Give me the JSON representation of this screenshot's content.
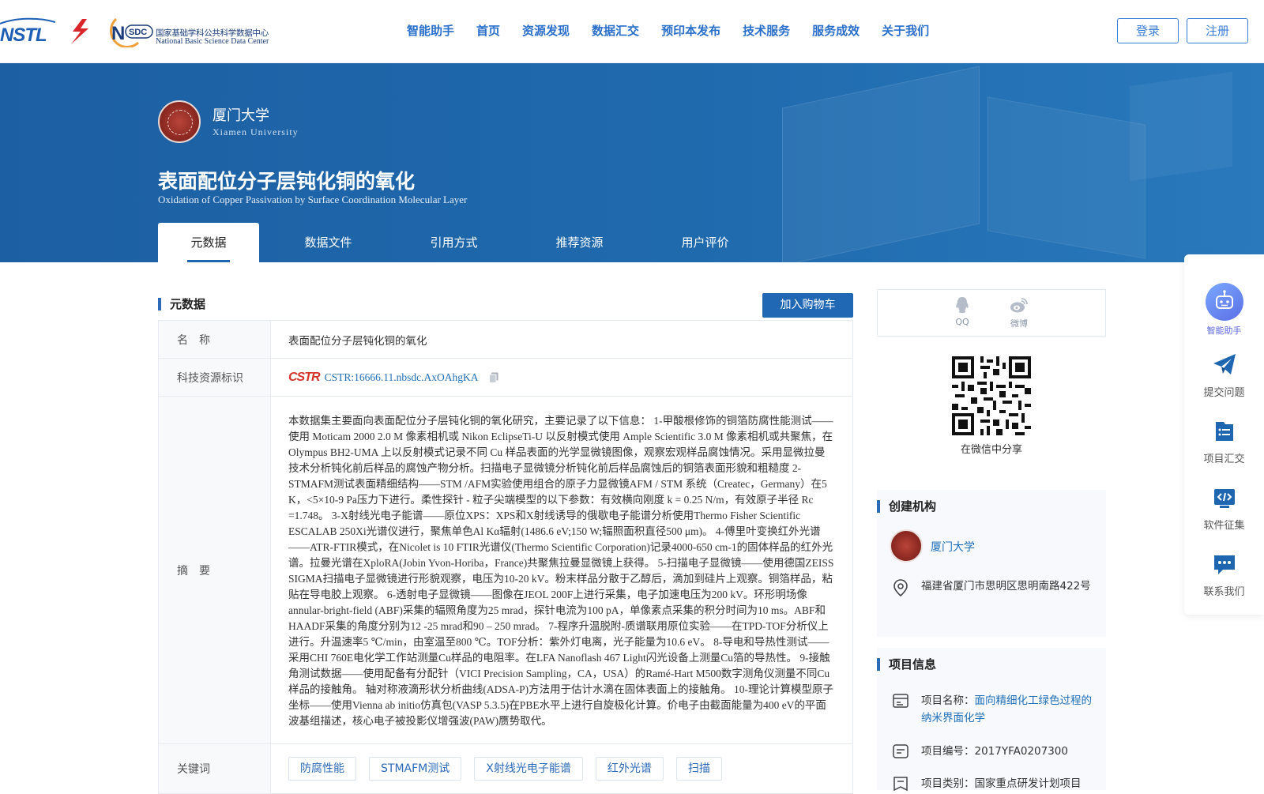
{
  "header": {
    "logos": [
      "NSTL",
      "NSDC"
    ],
    "nsdc_cn": "国家基础学科公共科学数据中心",
    "nsdc_en": "National Basic Science Data Center",
    "nav": [
      "智能助手",
      "首页",
      "资源发现",
      "数据汇交",
      "预印本发布",
      "技术服务",
      "服务成效",
      "关于我们"
    ],
    "login": "登录",
    "register": "注册"
  },
  "banner": {
    "org_cn": "厦门大学",
    "org_en": "Xiamen University",
    "title_cn": "表面配位分子层钝化铜的氧化",
    "title_en": "Oxidation of Copper Passivation by Surface Coordination Molecular Layer",
    "tabs": [
      "元数据",
      "数据文件",
      "引用方式",
      "推荐资源",
      "用户评价"
    ]
  },
  "metadata": {
    "section_title": "元数据",
    "cart_button": "加入购物车",
    "name_label": "名　称",
    "name_value": "表面配位分子层钝化铜的氧化",
    "id_label": "科技资源标识",
    "cstr_logo": "CSTR",
    "cstr_value": "CSTR:16666.11.nbsdc.AxOAhgKA",
    "abstract_label": "摘　要",
    "abstract": "本数据集主要面向表面配位分子层钝化铜的氧化研究，主要记录了以下信息： 1-甲酸根修饰的铜箔防腐性能测试——使用 Moticam 2000 2.0 M 像素相机或 Nikon EclipseTi-U 以反射模式使用 Ample Scientific 3.0 M 像素相机或共聚焦，在 Olympus BH2-UMA 上以反射模式记录不同 Cu 样品表面的光学显微镜图像，观察宏观样品腐蚀情况。采用显微拉曼技术分析钝化前后样品的腐蚀产物分析。扫描电子显微镜分析钝化前后样品腐蚀后的铜箔表面形貌和粗糙度 2-STMAFM测试表面精细结构——STM /AFM实验使用组合的原子力显微镜AFM / STM 系统（Createc，Germany）在5 K，<5×10-9 Pa压力下进行。柔性探针 - 粒子尖端模型的以下参数：有效横向刚度 k = 0.25 N/m，有效原子半径 Rc =1.748。 3-X射线光电子能谱——原位XPS：XPS和X射线诱导的俄歇电子能谱分析使用Thermo Fisher Scientific ESCALAB 250Xi光谱仪进行，聚焦单色Al Kα辐射(1486.6 eV;150 W;辐照面积直径500 μm)。 4-傅里叶变换红外光谱——ATR-FTIR模式，在Nicolet is 10 FTIR光谱仪(Thermo Scientific Corporation)记录4000-650 cm-1的固体样品的红外光谱。拉曼光谱在XploRA(Jobin Yvon-Horiba，France)共聚焦拉曼显微镜上获得。 5-扫描电子显微镜——使用德国ZEISS SIGMA扫描电子显微镜进行形貌观察，电压为10-20 kV。粉末样品分散于乙醇后，滴加到硅片上观察。铜箔样品，粘贴在导电胶上观察。 6-透射电子显微镜——图像在JEOL 200F上进行采集，电子加速电压为200 kV。环形明场像annular-bright-field (ABF)采集的辐照角度为25 mrad，探针电流为100 pA，单像素点采集的积分时间为10 ms。ABF和HAADF采集的角度分别为12 -25 mrad和90 – 250 mrad。 7-程序升温脱附-质谱联用原位实验——在TPD-TOF分析仪上进行。升温速率5 ℃/min，由室温至800 ℃。TOF分析：紫外灯电离，光子能量为10.6 eV。 8-导电和导热性测试——采用CHI 760E电化学工作站测量Cu样品的电阻率。在LFA Nanoflash 467 Light闪光设备上测量Cu箔的导热性。 9-接触角测试数据——使用配备有分配针（VICI Precision Sampling，CA，USA）的Ramé-Hart M500数字测角仪测量不同Cu样品的接触角。 轴对称液滴形状分析曲线(ADSA-P)方法用于估计水滴在固体表面上的接触角。 10-理论计算模型原子坐标——使用Vienna ab initio仿真包(VASP 5.3.5)在PBE水平上进行自旋极化计算。价电子由截面能量为400 eV的平面波基组描述，核心电子被投影仪增强波(PAW)赝势取代。",
    "keyword_label": "关键词",
    "keywords": [
      "防腐性能",
      "STMAFM测试",
      "X射线光电子能谱",
      "红外光谱",
      "扫描"
    ]
  },
  "share": {
    "qq": "QQ",
    "weibo": "微博",
    "qr_caption": "在微信中分享"
  },
  "org_card": {
    "title": "创建机构",
    "org_name": "厦门大学",
    "address": "福建省厦门市思明区思明南路422号"
  },
  "project_card": {
    "title": "项目信息",
    "name_prefix": "项目名称：",
    "name_value": "面向精细化工绿色过程的纳米界面化学",
    "code_text": "项目编号：2017YFA0207300",
    "type_text": "项目类别：国家重点研发计划项目"
  },
  "sidebar": {
    "items": [
      "智能助手",
      "提交问题",
      "项目汇交",
      "软件征集",
      "联系我们"
    ]
  },
  "colors": {
    "primary": "#2168b4",
    "banner": "#1f66b1",
    "link": "#1f6fb8"
  }
}
